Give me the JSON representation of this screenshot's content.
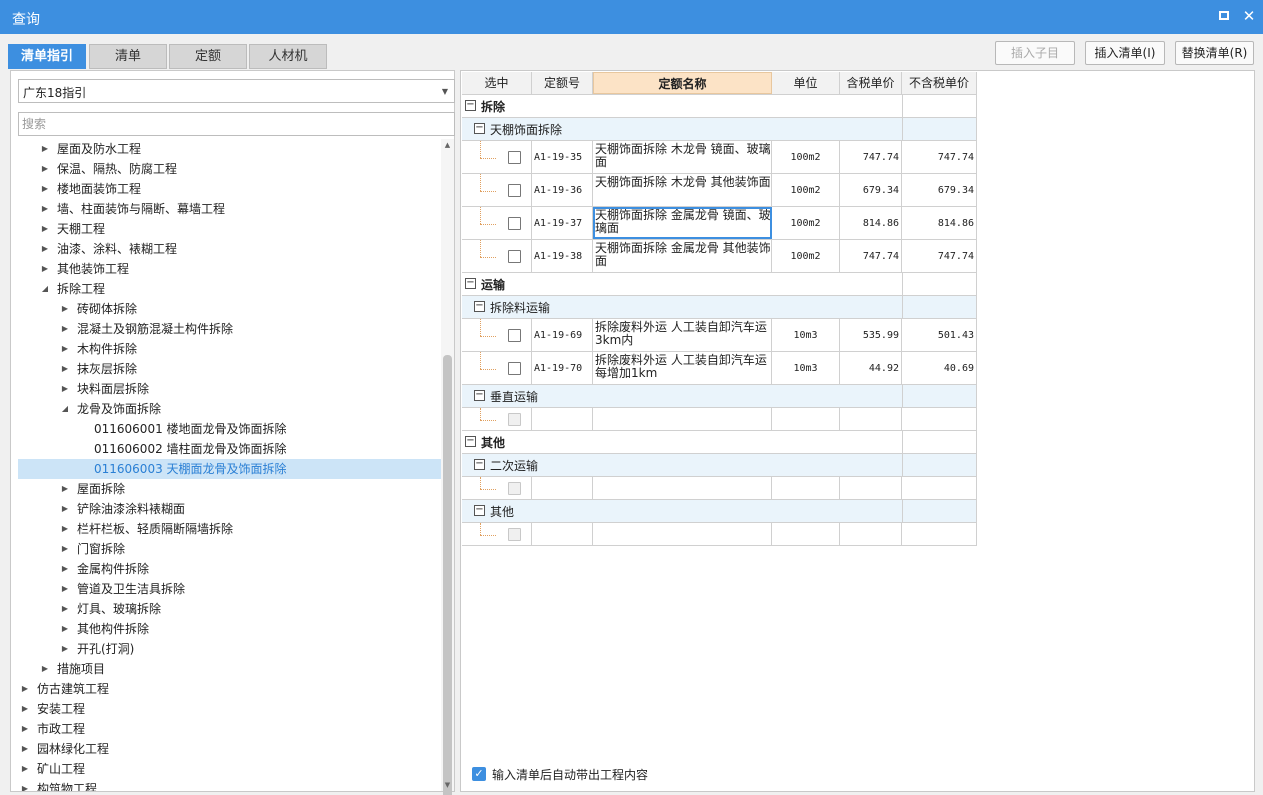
{
  "window": {
    "title": "查询"
  },
  "tabs": [
    "清单指引",
    "清单",
    "定额",
    "人材机"
  ],
  "buttons": {
    "insert_child": "插入子目",
    "insert_list": "插入清单(I)",
    "replace_list": "替换清单(R)"
  },
  "left": {
    "select_value": "广东18指引",
    "search_placeholder": "搜索",
    "tree": [
      {
        "label": "屋面及防水工程",
        "level": 1,
        "state": "collapsed"
      },
      {
        "label": "保温、隔热、防腐工程",
        "level": 1,
        "state": "collapsed"
      },
      {
        "label": "楼地面装饰工程",
        "level": 1,
        "state": "collapsed"
      },
      {
        "label": "墙、柱面装饰与隔断、幕墙工程",
        "level": 1,
        "state": "collapsed"
      },
      {
        "label": "天棚工程",
        "level": 1,
        "state": "collapsed"
      },
      {
        "label": "油漆、涂料、裱糊工程",
        "level": 1,
        "state": "collapsed"
      },
      {
        "label": "其他装饰工程",
        "level": 1,
        "state": "collapsed"
      },
      {
        "label": "拆除工程",
        "level": 1,
        "state": "expanded"
      },
      {
        "label": "砖砌体拆除",
        "level": 2,
        "state": "collapsed"
      },
      {
        "label": "混凝土及钢筋混凝土构件拆除",
        "level": 2,
        "state": "collapsed"
      },
      {
        "label": "木构件拆除",
        "level": 2,
        "state": "collapsed"
      },
      {
        "label": "抹灰层拆除",
        "level": 2,
        "state": "collapsed"
      },
      {
        "label": "块料面层拆除",
        "level": 2,
        "state": "collapsed"
      },
      {
        "label": "龙骨及饰面拆除",
        "level": 2,
        "state": "expanded"
      },
      {
        "label": "011606001  楼地面龙骨及饰面拆除",
        "level": 3,
        "state": "leaf"
      },
      {
        "label": "011606002  墙柱面龙骨及饰面拆除",
        "level": 3,
        "state": "leaf"
      },
      {
        "label": "011606003  天棚面龙骨及饰面拆除",
        "level": 3,
        "state": "leaf",
        "selected": true
      },
      {
        "label": "屋面拆除",
        "level": 2,
        "state": "collapsed"
      },
      {
        "label": "铲除油漆涂料裱糊面",
        "level": 2,
        "state": "collapsed"
      },
      {
        "label": "栏杆栏板、轻质隔断隔墙拆除",
        "level": 2,
        "state": "collapsed"
      },
      {
        "label": "门窗拆除",
        "level": 2,
        "state": "collapsed"
      },
      {
        "label": "金属构件拆除",
        "level": 2,
        "state": "collapsed"
      },
      {
        "label": "管道及卫生洁具拆除",
        "level": 2,
        "state": "collapsed"
      },
      {
        "label": "灯具、玻璃拆除",
        "level": 2,
        "state": "collapsed"
      },
      {
        "label": "其他构件拆除",
        "level": 2,
        "state": "collapsed"
      },
      {
        "label": "开孔(打洞)",
        "level": 2,
        "state": "collapsed"
      },
      {
        "label": "措施项目",
        "level": 1,
        "state": "collapsed"
      },
      {
        "label": "仿古建筑工程",
        "level": 0,
        "state": "collapsed"
      },
      {
        "label": "安装工程",
        "level": 0,
        "state": "collapsed"
      },
      {
        "label": "市政工程",
        "level": 0,
        "state": "collapsed"
      },
      {
        "label": "园林绿化工程",
        "level": 0,
        "state": "collapsed"
      },
      {
        "label": "矿山工程",
        "level": 0,
        "state": "collapsed"
      },
      {
        "label": "构筑物工程",
        "level": 0,
        "state": "collapsed"
      }
    ]
  },
  "grid": {
    "columns": [
      "选中",
      "定额号",
      "定额名称",
      "单位",
      "含税单价",
      "不含税单价"
    ],
    "rows": [
      {
        "type": "group",
        "label": "拆除"
      },
      {
        "type": "subgroup",
        "label": "天棚饰面拆除"
      },
      {
        "type": "item",
        "code": "A1-19-35",
        "name": "天棚饰面拆除 木龙骨 镜面、玻璃面",
        "unit": "100m2",
        "tax_price": "747.74",
        "notax_price": "747.74"
      },
      {
        "type": "item",
        "code": "A1-19-36",
        "name": "天棚饰面拆除 木龙骨 其他装饰面",
        "unit": "100m2",
        "tax_price": "679.34",
        "notax_price": "679.34"
      },
      {
        "type": "item",
        "code": "A1-19-37",
        "name": "天棚饰面拆除 金属龙骨 镜面、玻璃面",
        "unit": "100m2",
        "tax_price": "814.86",
        "notax_price": "814.86",
        "focused": true
      },
      {
        "type": "item",
        "code": "A1-19-38",
        "name": "天棚饰面拆除 金属龙骨 其他装饰面",
        "unit": "100m2",
        "tax_price": "747.74",
        "notax_price": "747.74"
      },
      {
        "type": "group",
        "label": "运输"
      },
      {
        "type": "subgroup",
        "label": "拆除料运输"
      },
      {
        "type": "item",
        "code": "A1-19-69",
        "name": "拆除废料外运 人工装自卸汽车运3km内",
        "unit": "10m3",
        "tax_price": "535.99",
        "notax_price": "501.43"
      },
      {
        "type": "item",
        "code": "A1-19-70",
        "name": "拆除废料外运 人工装自卸汽车运每增加1km",
        "unit": "10m3",
        "tax_price": "44.92",
        "notax_price": "40.69"
      },
      {
        "type": "subgroup",
        "label": "垂直运输"
      },
      {
        "type": "empty"
      },
      {
        "type": "group",
        "label": "其他"
      },
      {
        "type": "subgroup",
        "label": "二次运输"
      },
      {
        "type": "empty"
      },
      {
        "type": "subgroup",
        "label": "其他"
      },
      {
        "type": "empty"
      }
    ]
  },
  "footer": {
    "auto_bring_label": "输入清单后自动带出工程内容",
    "checked": true
  }
}
